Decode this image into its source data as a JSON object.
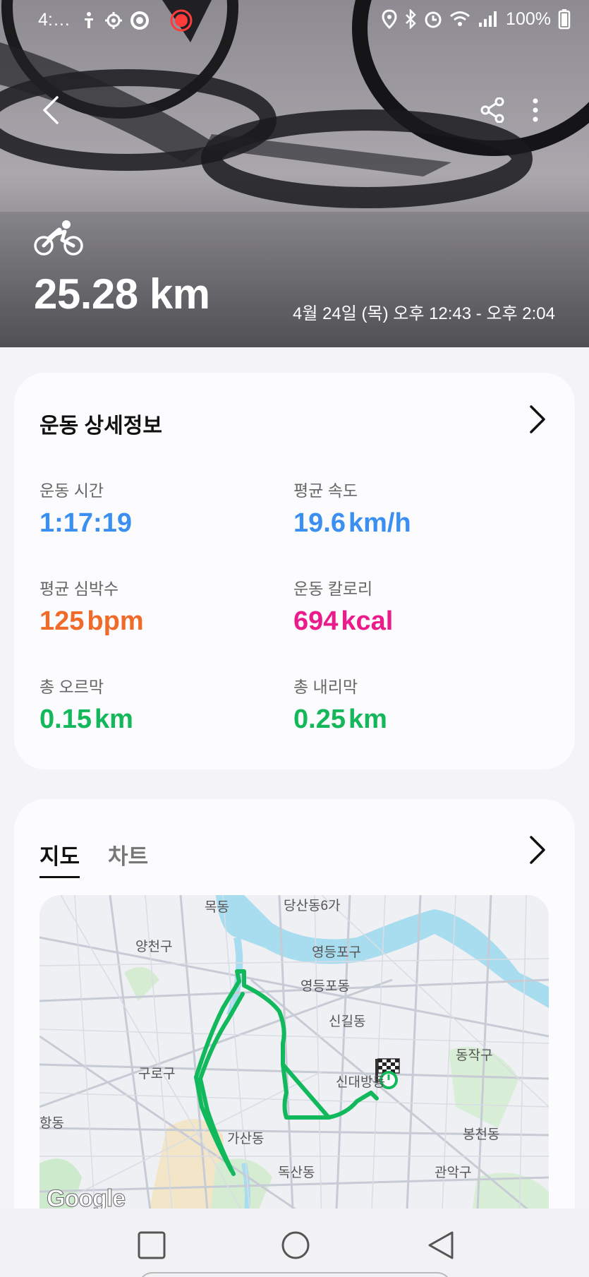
{
  "status_bar": {
    "time": "4:…",
    "battery": "100%",
    "left_icons": [
      "accessibility-icon",
      "settings-icon",
      "record-outline-icon",
      "screen-record-icon"
    ],
    "right_icons": [
      "location-icon",
      "bluetooth-icon",
      "alarm-icon",
      "wifi-icon",
      "signal-icon",
      "battery-icon"
    ]
  },
  "hero": {
    "activity_icon": "cycling-icon",
    "distance": "25.28 km",
    "datetime": "4월 24일 (목) 오후 12:43 - 오후 2:04"
  },
  "details": {
    "title": "운동 상세정보",
    "stats": [
      {
        "label": "운동 시간",
        "value": "1:17:19",
        "unit": "",
        "color": "#3b8ff0"
      },
      {
        "label": "평균 속도",
        "value": "19.6",
        "unit": "km/h",
        "color": "#3b8ff0"
      },
      {
        "label": "평균 심박수",
        "value": "125",
        "unit": "bpm",
        "color": "#f06a2a"
      },
      {
        "label": "운동 칼로리",
        "value": "694",
        "unit": "kcal",
        "color": "#ec1b8c"
      },
      {
        "label": "총 오르막",
        "value": "0.15",
        "unit": "km",
        "color": "#14b85a"
      },
      {
        "label": "총 내리막",
        "value": "0.25",
        "unit": "km",
        "color": "#14b85a"
      }
    ]
  },
  "map_section": {
    "tabs": [
      "지도",
      "차트"
    ],
    "active_tab": "지도",
    "map_labels": [
      "목동",
      "당산동6가",
      "양천구",
      "영등포구",
      "영등포동",
      "신길동",
      "동작구",
      "구로구",
      "신대방동",
      "항동",
      "가산동",
      "봉천동",
      "관악구",
      "독산동"
    ],
    "google_label": "Google",
    "route_color": "#12b85c"
  },
  "nav_bar": {
    "buttons": [
      "recents-icon",
      "home-icon",
      "back-icon"
    ]
  }
}
